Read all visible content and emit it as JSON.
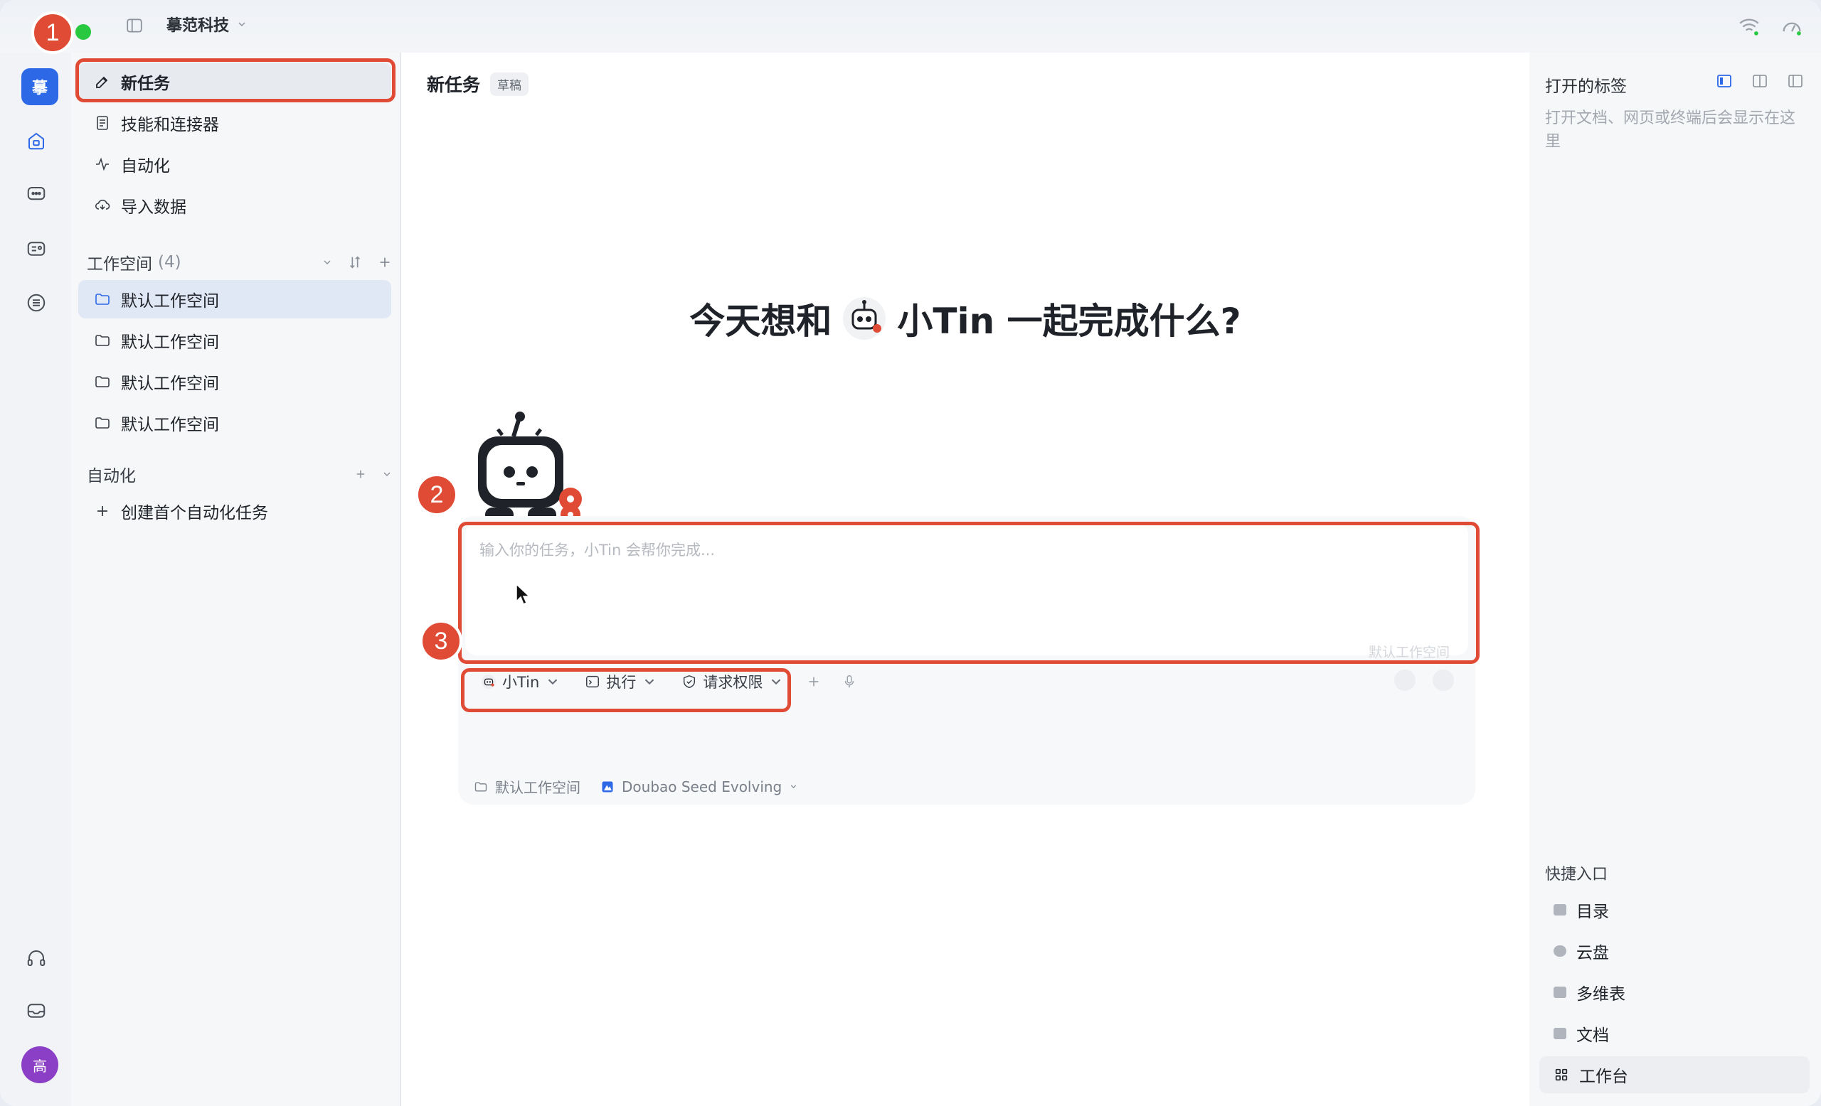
{
  "titlebar": {
    "org": "摹范科技"
  },
  "rail": {
    "brand_glyph": "摹",
    "avatar_glyph": "高"
  },
  "nav": {
    "items": [
      {
        "label": "新任务",
        "icon": "edit-icon"
      },
      {
        "label": "技能和连接器",
        "icon": "document-icon"
      },
      {
        "label": "自动化",
        "icon": "activity-icon"
      },
      {
        "label": "导入数据",
        "icon": "cloud-import-icon"
      }
    ]
  },
  "workspaces": {
    "title": "工作空间",
    "count": "(4)",
    "items": [
      "默认工作空间",
      "默认工作空间",
      "默认工作空间",
      "默认工作空间"
    ]
  },
  "automation": {
    "title": "自动化",
    "create_label": "创建首个自动化任务"
  },
  "main": {
    "title": "新任务",
    "draft": "草稿",
    "hero_prefix": "今天想和",
    "hero_suffix": "小Tin 一起完成什么?",
    "input_placeholder": "输入你的任务，小Tin 会帮你完成...",
    "workspace_hint": "默认工作空间",
    "agent": "小Tin",
    "mode": "执行",
    "permission": "请求权限",
    "workspace": "默认工作空间",
    "model": "Doubao Seed Evolving"
  },
  "right": {
    "title": "打开的标签",
    "hint": "打开文档、网页或终端后会显示在这里",
    "quick_title": "快捷入口",
    "quick_items": [
      "目录",
      "云盘",
      "多维表",
      "文档",
      "工作台"
    ]
  },
  "annotations": {
    "n1": "1",
    "n2": "2",
    "n3": "3"
  },
  "colors": {
    "accent": "#2d68e6",
    "highlight": "#e04b35",
    "avatar": "#8b3fc6"
  }
}
